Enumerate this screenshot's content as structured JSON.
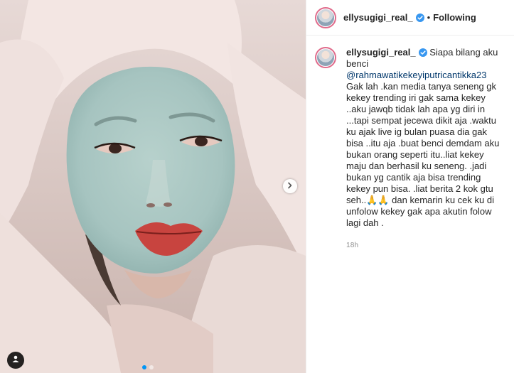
{
  "post": {
    "username": "ellysugigi_real_",
    "follow_status": "Following",
    "separator": "•",
    "caption": {
      "intro": "Siapa bilang aku benci",
      "mention": "@rahmawatikekeyiputricantikka23",
      "body": "Gak lah .kan media tanya seneng gk kekey trending iri gak sama kekey ..aku jawqb tidak lah apa yg diri in ...tapi sempat jecewa dikit aja .waktu ku ajak live ig bulan puasa dia gak bisa ..itu aja .buat benci demdam aku bukan orang seperti itu..liat kekey maju dan berhasil ku seneng. .jadi bukan yg cantik aja bisa trending kekey pun bisa. .liat berita 2 kok gtu seh..🙏🙏 dan kemarin ku cek ku di unfolow kekey gak apa akutin folow lagi dah ."
    },
    "timestamp": "18h",
    "carousel": {
      "total": 2,
      "current": 1
    }
  },
  "icons": {
    "verified": "verified-badge-icon",
    "next": "chevron-right-icon",
    "user_tag": "user-tag-icon"
  },
  "colors": {
    "verified_blue": "#3897f0",
    "mention": "#00376b",
    "muted": "#8e8e8e",
    "carousel_active": "#0095f6"
  }
}
